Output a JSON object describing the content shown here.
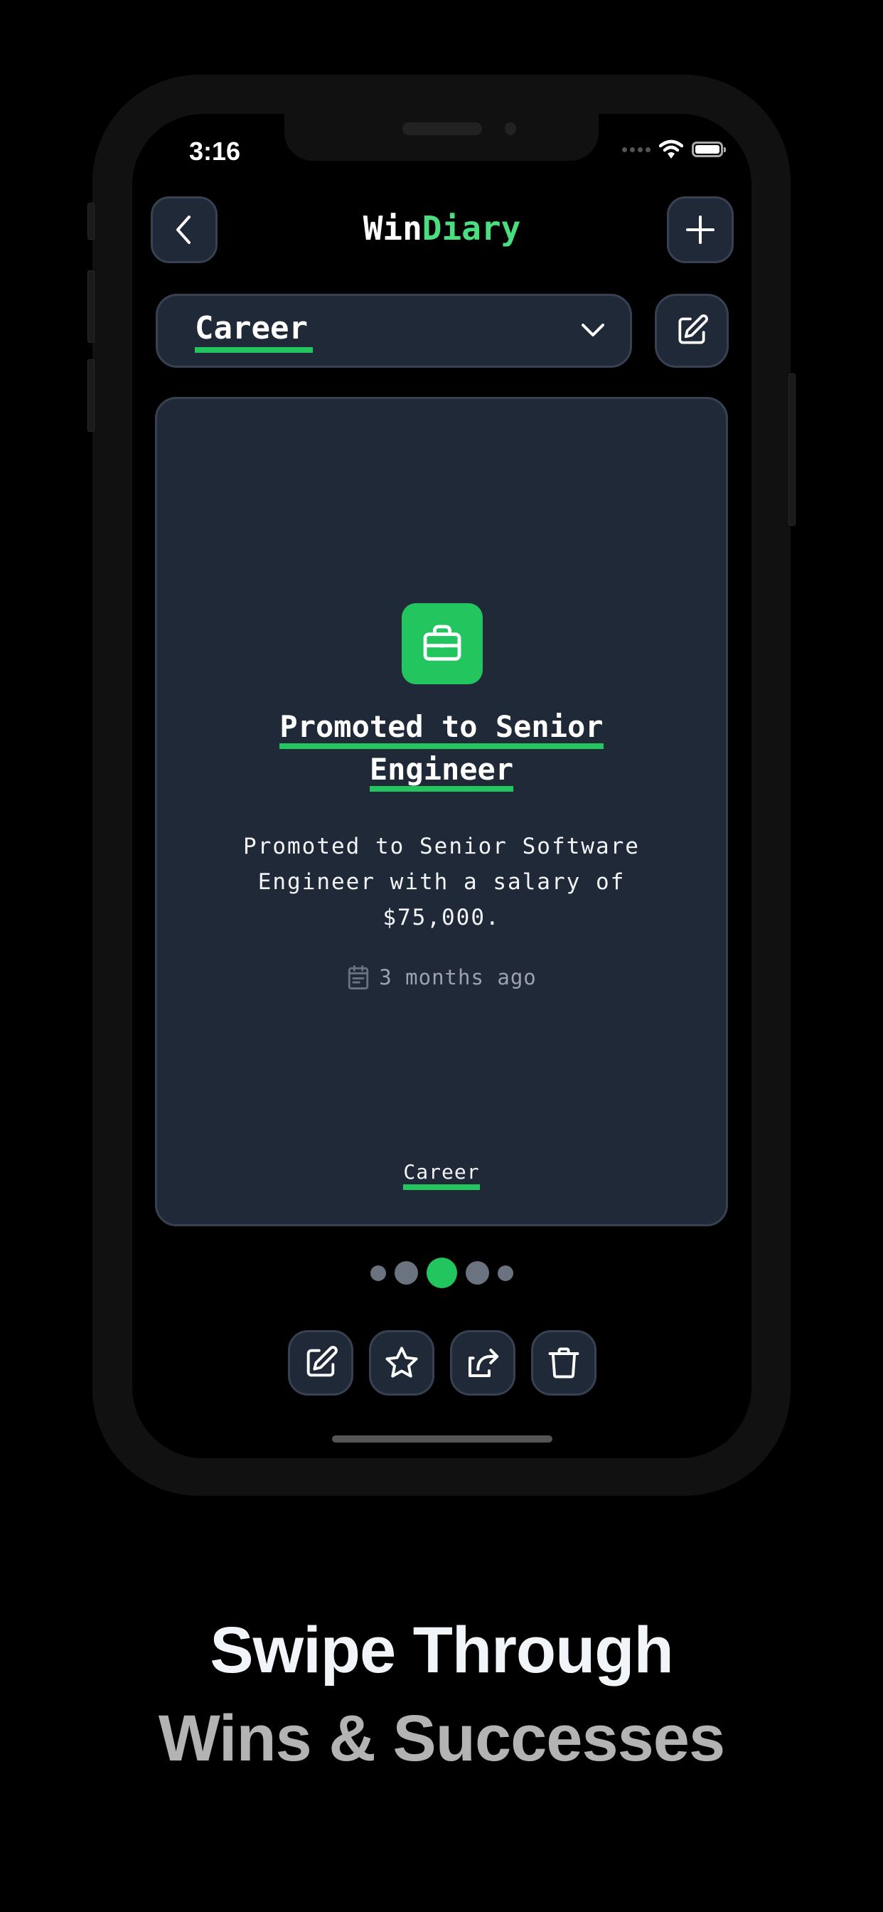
{
  "status_bar": {
    "time": "3:16"
  },
  "header": {
    "title_primary": "Win",
    "title_accent": "Diary",
    "back_icon": "chevron-left-icon",
    "add_icon": "plus-icon"
  },
  "category_selector": {
    "selected": "Career",
    "dropdown_icon": "chevron-down-icon",
    "edit_icon": "edit-icon"
  },
  "win_card": {
    "icon": "briefcase-icon",
    "title": "Promoted to Senior Engineer",
    "title_lines": [
      "Promoted to Senior",
      "Engineer"
    ],
    "description": "Promoted to Senior Software Engineer with a salary of $75,000.",
    "date_icon": "calendar-icon",
    "date": "3 months ago",
    "category_tag": "Career"
  },
  "pagination": {
    "count": 5,
    "active_index": 2
  },
  "actions": [
    {
      "name": "edit",
      "icon": "edit-icon"
    },
    {
      "name": "favorite",
      "icon": "star-icon"
    },
    {
      "name": "share",
      "icon": "share-icon"
    },
    {
      "name": "delete",
      "icon": "trash-icon"
    }
  ],
  "marketing": {
    "line1": "Swipe Through",
    "line2": "Wins & Successes"
  },
  "colors": {
    "accent": "#22c55e",
    "title_accent": "#4ade80",
    "surface": "#1f2937",
    "border": "#374151",
    "muted": "#9ca3af",
    "dot_inactive": "#6b7280"
  }
}
